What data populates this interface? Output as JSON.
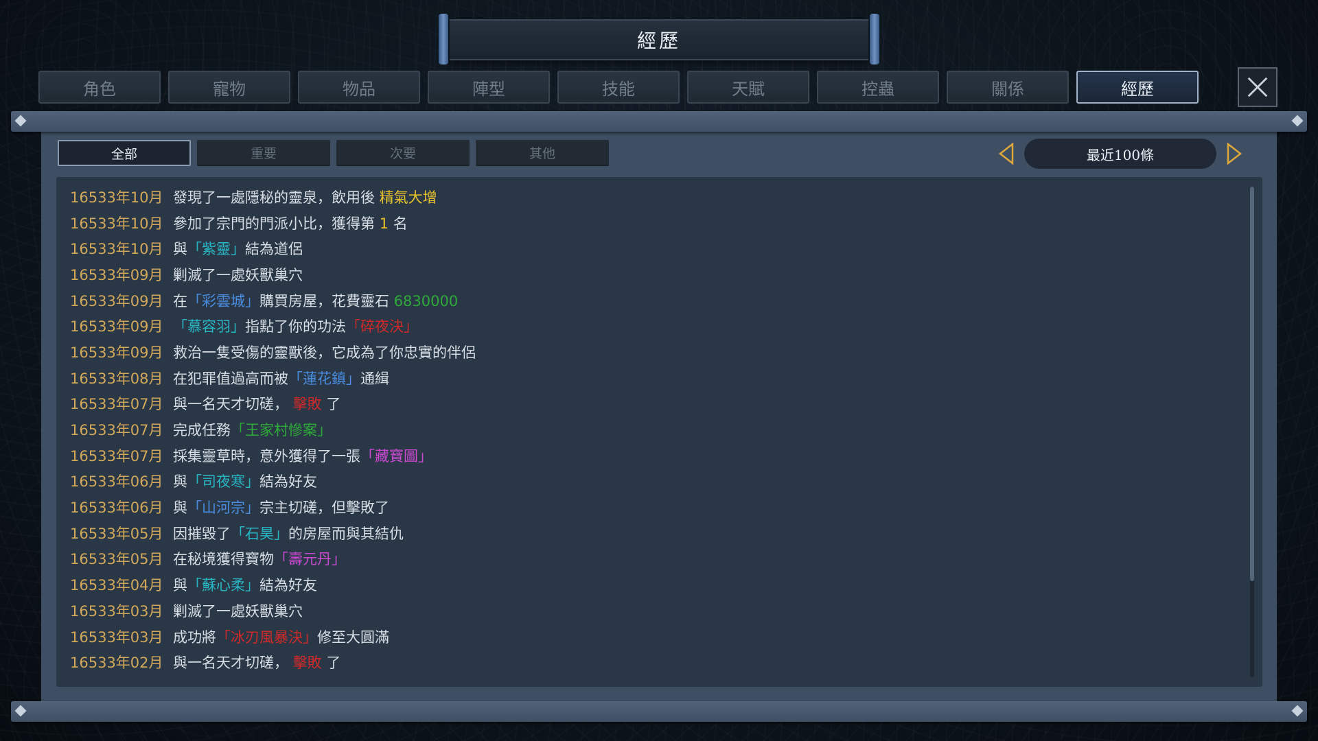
{
  "title": "經歷",
  "tabs": [
    "角色",
    "寵物",
    "物品",
    "陣型",
    "技能",
    "天賦",
    "控蟲",
    "關係",
    "經歷"
  ],
  "active_tab": "經歷",
  "filters": [
    "全部",
    "重要",
    "次要",
    "其他"
  ],
  "active_filter": "全部",
  "range_label": "最近100條",
  "colors": {
    "yellow": "#e6c12d",
    "cyan": "#28b6c4",
    "blue": "#4a8de0",
    "green": "#2faa3a",
    "red": "#cf2a2a",
    "purple": "#c94ad0",
    "date": "#d2a85a"
  },
  "entries": [
    {
      "date": "16533年10月",
      "parts": [
        {
          "t": "發現了一處隱秘的靈泉，飲用後 "
        },
        {
          "t": "精氣大增",
          "c": "yellow"
        }
      ]
    },
    {
      "date": "16533年10月",
      "parts": [
        {
          "t": "參加了宗門的門派小比，獲得第 "
        },
        {
          "t": "1",
          "c": "yellow"
        },
        {
          "t": " 名"
        }
      ]
    },
    {
      "date": "16533年10月",
      "parts": [
        {
          "t": "與"
        },
        {
          "t": "「紫靈」",
          "c": "cyan"
        },
        {
          "t": "結為道侶"
        }
      ]
    },
    {
      "date": "16533年09月",
      "parts": [
        {
          "t": "剿滅了一處妖獸巢穴"
        }
      ]
    },
    {
      "date": "16533年09月",
      "parts": [
        {
          "t": "在"
        },
        {
          "t": "「彩雲城」",
          "c": "blue"
        },
        {
          "t": "購買房屋，花費靈石 "
        },
        {
          "t": "6830000",
          "c": "green"
        }
      ]
    },
    {
      "date": "16533年09月",
      "parts": [
        {
          "t": "「慕容羽」",
          "c": "cyan"
        },
        {
          "t": "指點了你的功法"
        },
        {
          "t": "「碎夜決」",
          "c": "red"
        }
      ]
    },
    {
      "date": "16533年09月",
      "parts": [
        {
          "t": "救治一隻受傷的靈獸後，它成為了你忠實的伴侶"
        }
      ]
    },
    {
      "date": "16533年08月",
      "parts": [
        {
          "t": "在犯罪值過高而被"
        },
        {
          "t": "「蓮花鎮」",
          "c": "blue"
        },
        {
          "t": "通緝"
        }
      ]
    },
    {
      "date": "16533年07月",
      "parts": [
        {
          "t": "與一名天才切磋， "
        },
        {
          "t": "擊敗",
          "c": "red"
        },
        {
          "t": " 了"
        }
      ]
    },
    {
      "date": "16533年07月",
      "parts": [
        {
          "t": "完成任務"
        },
        {
          "t": "「王家村慘案」",
          "c": "green"
        }
      ]
    },
    {
      "date": "16533年07月",
      "parts": [
        {
          "t": "採集靈草時，意外獲得了一張"
        },
        {
          "t": "「藏寶圖」",
          "c": "purple"
        }
      ]
    },
    {
      "date": "16533年06月",
      "parts": [
        {
          "t": "與"
        },
        {
          "t": "「司夜寒」",
          "c": "cyan"
        },
        {
          "t": "結為好友"
        }
      ]
    },
    {
      "date": "16533年06月",
      "parts": [
        {
          "t": "與"
        },
        {
          "t": "「山河宗」",
          "c": "blue"
        },
        {
          "t": "宗主切磋，但擊敗了"
        }
      ]
    },
    {
      "date": "16533年05月",
      "parts": [
        {
          "t": "因摧毀了"
        },
        {
          "t": "「石昊」",
          "c": "cyan"
        },
        {
          "t": "的房屋而與其結仇"
        }
      ]
    },
    {
      "date": "16533年05月",
      "parts": [
        {
          "t": "在秘境獲得寶物"
        },
        {
          "t": "「壽元丹」",
          "c": "purple"
        }
      ]
    },
    {
      "date": "16533年04月",
      "parts": [
        {
          "t": "與"
        },
        {
          "t": "「蘇心柔」",
          "c": "cyan"
        },
        {
          "t": "結為好友"
        }
      ]
    },
    {
      "date": "16533年03月",
      "parts": [
        {
          "t": "剿滅了一處妖獸巢穴"
        }
      ]
    },
    {
      "date": "16533年03月",
      "parts": [
        {
          "t": "成功將"
        },
        {
          "t": "「冰刃風暴決」",
          "c": "red"
        },
        {
          "t": "修至大圓滿"
        }
      ]
    },
    {
      "date": "16533年02月",
      "parts": [
        {
          "t": "與一名天才切磋， "
        },
        {
          "t": "擊敗",
          "c": "red"
        },
        {
          "t": " 了"
        }
      ]
    }
  ]
}
